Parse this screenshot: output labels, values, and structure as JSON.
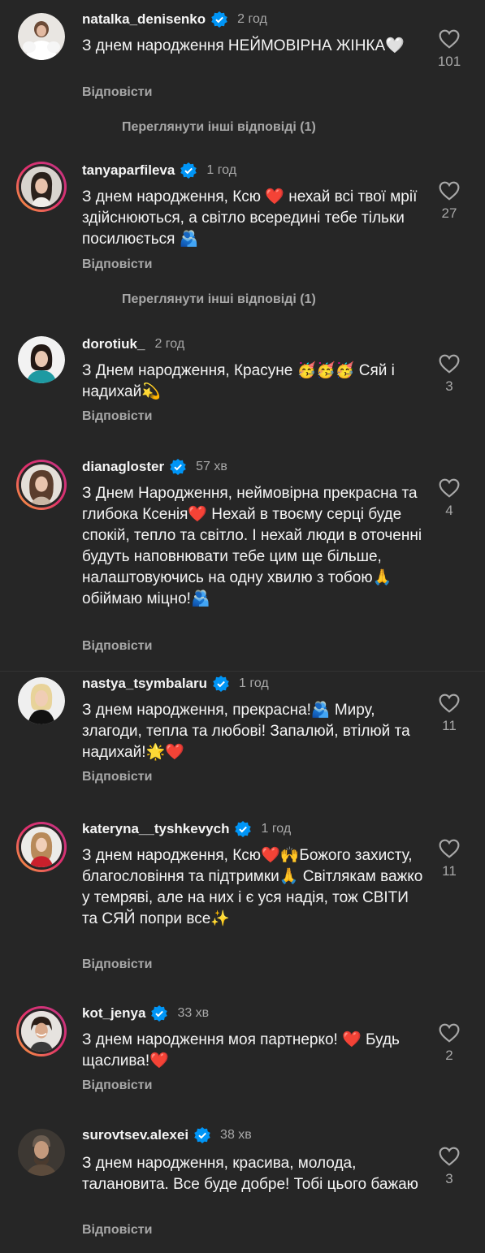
{
  "ui": {
    "reply_label": "Відповісти",
    "more_replies_label": "Переглянути інші відповіді (1)"
  },
  "colors": {
    "background": "#262626",
    "verified": "#0095f6",
    "secondary_text": "#a8a8a8"
  },
  "comments": [
    {
      "username": "natalka_denisenko",
      "verified": true,
      "time": "2 год",
      "text": "З днем народження НЕЙМОВІРНА ЖІНКА🤍",
      "likes": "101",
      "story_ring": false,
      "icon": "heart-outline-icon"
    },
    {
      "username": "tanyaparfileva",
      "verified": true,
      "time": "1 год",
      "text": "З днем народження, Ксю ❤️ нехай всі твої мрії здійснюються, а світло всередині тебе тільки посилюється 🫂",
      "likes": "27",
      "story_ring": true,
      "icon": "heart-outline-icon"
    },
    {
      "username": "dorotiuk_",
      "verified": false,
      "time": "2 год",
      "text": "З Днем народження, Красуне 🥳🥳🥳 Сяй і надихай💫",
      "likes": "3",
      "story_ring": false,
      "icon": "heart-outline-icon"
    },
    {
      "username": "dianagloster",
      "verified": true,
      "time": "57 хв",
      "text": "З Днем Народження, неймовірна прекрасна та глибока Ксенія❤️ Нехай в твоєму серці буде спокій, тепло та світло. І нехай люди в оточенні будуть наповнювати тебе цим ще більше, налаштовуючись на одну хвилю з тобою🙏 обіймаю міцно!🫂",
      "likes": "4",
      "story_ring": true,
      "icon": "heart-outline-icon"
    },
    {
      "username": "nastya_tsymbalaru",
      "verified": true,
      "time": "1 год",
      "text": "З днем народження, прекрасна!🫂 Миру, злагоди, тепла та любові! Запалюй, втілюй та надихай!🌟❤️",
      "likes": "11",
      "story_ring": false,
      "icon": "heart-outline-icon"
    },
    {
      "username": "kateryna__tyshkevych",
      "verified": true,
      "time": "1 год",
      "text": "З днем народження, Ксю❤️🙌Божого захисту, благословіння та підтримки🙏 Світлякам важко у темряві, але на них і є уся надія, тож СВІТИ та СЯЙ попри все✨",
      "likes": "11",
      "story_ring": true,
      "icon": "heart-outline-icon"
    },
    {
      "username": "kot_jenya",
      "verified": true,
      "time": "33 хв",
      "text": "З днем народження моя партнерко! ❤️ Будь щаслива!❤️",
      "likes": "2",
      "story_ring": true,
      "icon": "heart-outline-icon"
    },
    {
      "username": "surovtsev.alexei",
      "verified": true,
      "time": "38 хв",
      "text": "З днем народження, красива, молода, талановита. Все буде добре! Тобі цього бажаю",
      "likes": "3",
      "story_ring": false,
      "icon": "heart-outline-icon"
    }
  ]
}
